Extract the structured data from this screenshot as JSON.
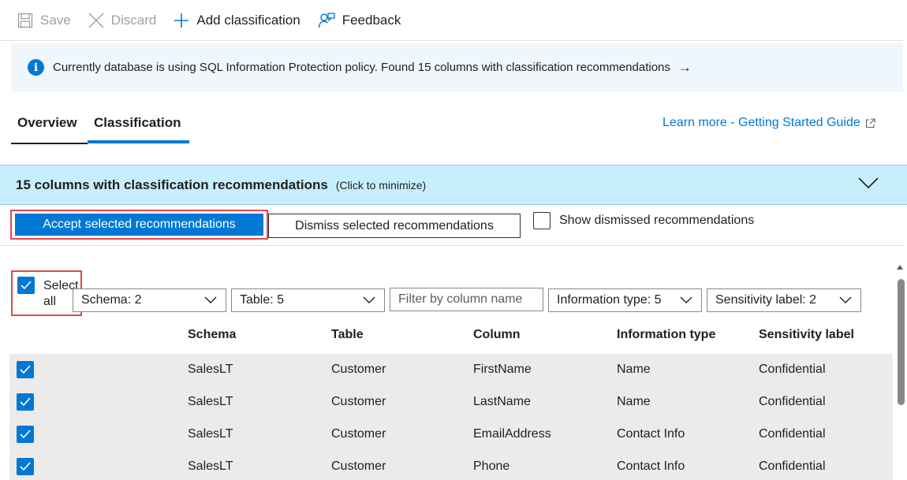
{
  "toolbar": {
    "save": "Save",
    "discard": "Discard",
    "add_classification": "Add classification",
    "feedback": "Feedback"
  },
  "banner": {
    "text": "Currently database is using SQL Information Protection policy. Found 15 columns with classification recommendations",
    "arrow": "→"
  },
  "tabs": [
    {
      "label": "Overview"
    },
    {
      "label": "Classification"
    }
  ],
  "learn_more": "Learn more - Getting Started Guide",
  "recommendations": {
    "title": "15 columns with classification recommendations",
    "hint": "(Click to minimize)",
    "accept_label": "Accept selected recommendations",
    "dismiss_label": "Dismiss selected recommendations",
    "show_dismissed_label": "Show dismissed recommendations"
  },
  "filters": {
    "select_all_line1": "Select",
    "select_all_line2": "all",
    "schema": "Schema: 2",
    "table": "Table: 5",
    "column_placeholder": "Filter by column name",
    "information_type": "Information type: 5",
    "sensitivity_label": "Sensitivity label: 2"
  },
  "table": {
    "headers": [
      "Schema",
      "Table",
      "Column",
      "Information type",
      "Sensitivity label"
    ],
    "rows": [
      {
        "schema": "SalesLT",
        "table": "Customer",
        "column": "FirstName",
        "info_type": "Name",
        "label": "Confidential"
      },
      {
        "schema": "SalesLT",
        "table": "Customer",
        "column": "LastName",
        "info_type": "Name",
        "label": "Confidential"
      },
      {
        "schema": "SalesLT",
        "table": "Customer",
        "column": "EmailAddress",
        "info_type": "Contact Info",
        "label": "Confidential"
      },
      {
        "schema": "SalesLT",
        "table": "Customer",
        "column": "Phone",
        "info_type": "Contact Info",
        "label": "Confidential"
      }
    ]
  },
  "colors": {
    "accent": "#0078d4",
    "banner_bg": "#eff6fc",
    "header_bg": "#c7eefd",
    "row_bg": "#edebe9",
    "highlight": "#e0474e"
  }
}
